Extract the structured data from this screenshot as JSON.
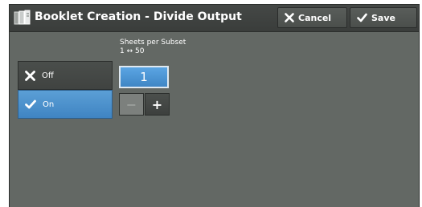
{
  "header": {
    "title": "Booklet Creation - Divide Output",
    "title_icon": "booklet-icon",
    "cancel_label": "Cancel",
    "save_label": "Save"
  },
  "sheets_per_subset": {
    "label": "Sheets per Subset",
    "range": "1 ↔ 50",
    "value": "1",
    "decrement_symbol": "−",
    "increment_symbol": "+"
  },
  "options": {
    "off_label": "Off",
    "on_label": "On",
    "selected": "On"
  },
  "colors": {
    "background": "#636864",
    "selected_blue": "#4a90cf",
    "header": "#3f4240"
  }
}
